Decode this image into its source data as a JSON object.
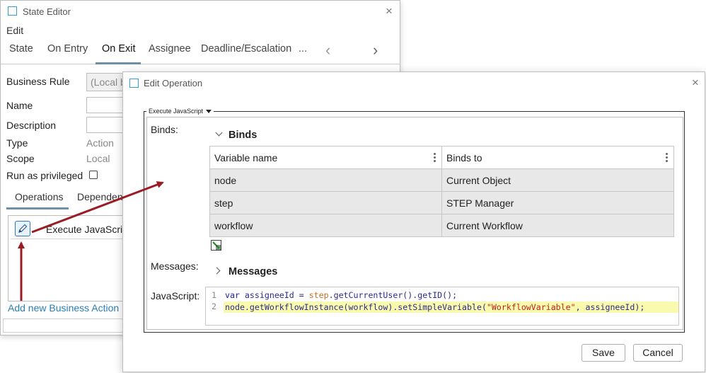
{
  "state_editor": {
    "title": "State Editor",
    "menu_edit": "Edit",
    "tabs": [
      "State",
      "On Entry",
      "On Exit",
      "Assignee",
      "Deadline/Escalation",
      "..."
    ],
    "active_tab": "On Exit",
    "fields": {
      "business_rule_label": "Business Rule",
      "business_rule_value": "(Local b",
      "name_label": "Name",
      "description_label": "Description",
      "type_label": "Type",
      "type_value": "Action",
      "scope_label": "Scope",
      "scope_value": "Local",
      "privileged_label": "Run as privileged"
    },
    "subtabs": [
      "Operations",
      "Dependen"
    ],
    "active_subtab": "Operations",
    "operation_label": "Execute JavaScrip",
    "add_link": "Add new Business Action"
  },
  "edit_operation": {
    "title": "Edit Operation",
    "group_legend": "Execute JavaScript",
    "binds_label": "Binds:",
    "binds_section": "Binds",
    "table": {
      "headers": [
        "Variable name",
        "Binds to"
      ],
      "rows": [
        [
          "node",
          "Current Object"
        ],
        [
          "step",
          "STEP Manager"
        ],
        [
          "workflow",
          "Current Workflow"
        ]
      ]
    },
    "messages_label": "Messages:",
    "messages_section": "Messages",
    "javascript_label": "JavaScript:",
    "code": {
      "line_numbers": [
        "1",
        "2"
      ],
      "line1": {
        "kw": "var",
        "ident": " assigneeId = ",
        "obj": "step",
        "rest": ".getCurrentUser().getID();"
      },
      "line2": {
        "pre": "node.getWorkflowInstance(workflow).setSimpleVariable(",
        "str": "\"WorkflowVariable\"",
        "post": ", assigneeId);"
      }
    },
    "save_label": "Save",
    "cancel_label": "Cancel"
  },
  "colors": {
    "accent": "#2b9fd6",
    "link": "#2a7fb8",
    "annotation_arrow": "#9b1c24",
    "code_highlight": "#fafaae"
  }
}
